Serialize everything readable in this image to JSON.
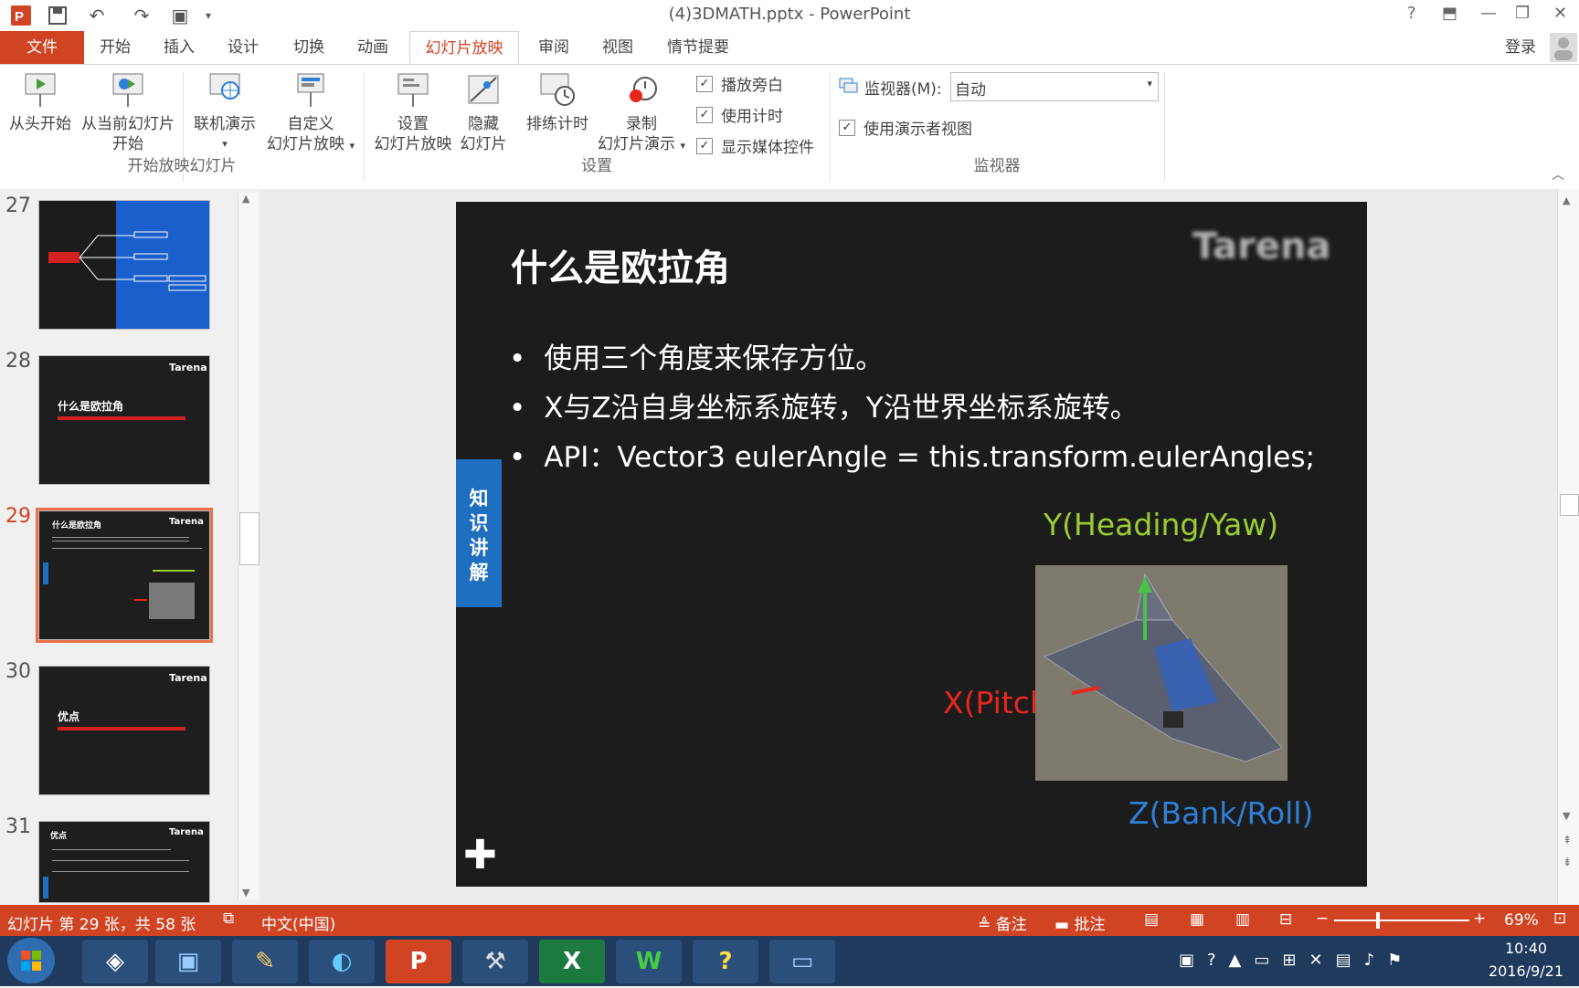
{
  "window": {
    "title": "(4)3DMATH.pptx - PowerPoint",
    "help": "?",
    "login": "登录"
  },
  "tabs": [
    "文件",
    "开始",
    "插入",
    "设计",
    "切换",
    "动画",
    "幻灯片放映",
    "审阅",
    "视图",
    "情节提要"
  ],
  "ribbon": {
    "start_group": {
      "from_beginning": "从头开始",
      "from_current_l1": "从当前幻灯片",
      "from_current_l2": "开始",
      "online": "联机演示",
      "custom_l1": "自定义",
      "custom_l2": "幻灯片放映",
      "label": "开始放映幻灯片"
    },
    "setup_group": {
      "setup_l1": "设置",
      "setup_l2": "幻灯片放映",
      "hide_l1": "隐藏",
      "hide_l2": "幻灯片",
      "rehearse": "排练计时",
      "record_l1": "录制",
      "record_l2": "幻灯片演示",
      "chk_narration": "播放旁白",
      "chk_timing": "使用计时",
      "chk_media": "显示媒体控件",
      "label": "设置"
    },
    "monitor_group": {
      "monitor_label": "监视器(M):",
      "monitor_value": "自动",
      "presenter_view": "使用演示者视图",
      "label": "监视器"
    }
  },
  "thumbnails": [
    {
      "num": "27",
      "title": ""
    },
    {
      "num": "28",
      "title": "什么是欧拉角",
      "brand": "Tarena"
    },
    {
      "num": "29",
      "title": "什么是欧拉角",
      "brand": "Tarena"
    },
    {
      "num": "30",
      "title": "优点",
      "brand": "Tarena"
    },
    {
      "num": "31",
      "title": "优点",
      "brand": "Tarena"
    }
  ],
  "slide": {
    "title": "什么是欧拉角",
    "bullets": [
      "使用三个角度来保存方位。",
      "X与Z沿自身坐标系旋转，Y沿世界坐标系旋转。",
      "API：Vector3 eulerAngle = this.transform.eulerAngles;"
    ],
    "side_tab": [
      "知",
      "识",
      "讲",
      "解"
    ],
    "label_y": "Y(Heading/Yaw)",
    "label_x": "X(Pitch)",
    "label_z": "Z(Bank/Roll)",
    "logo": "Tarena"
  },
  "status": {
    "slide_info": "幻灯片 第 29 张，共 58 张",
    "language": "中文(中国)",
    "notes": "备注",
    "comments": "批注",
    "zoom": "69%"
  },
  "taskbar": {
    "time": "10:40",
    "date": "2016/9/21"
  },
  "colors": {
    "accent": "#d04423",
    "slide_bg": "#1c1c1c",
    "y_label": "#9acd32",
    "x_label": "#e8261c",
    "z_label": "#2e7fd6",
    "side_tab": "#1f6fc0"
  }
}
